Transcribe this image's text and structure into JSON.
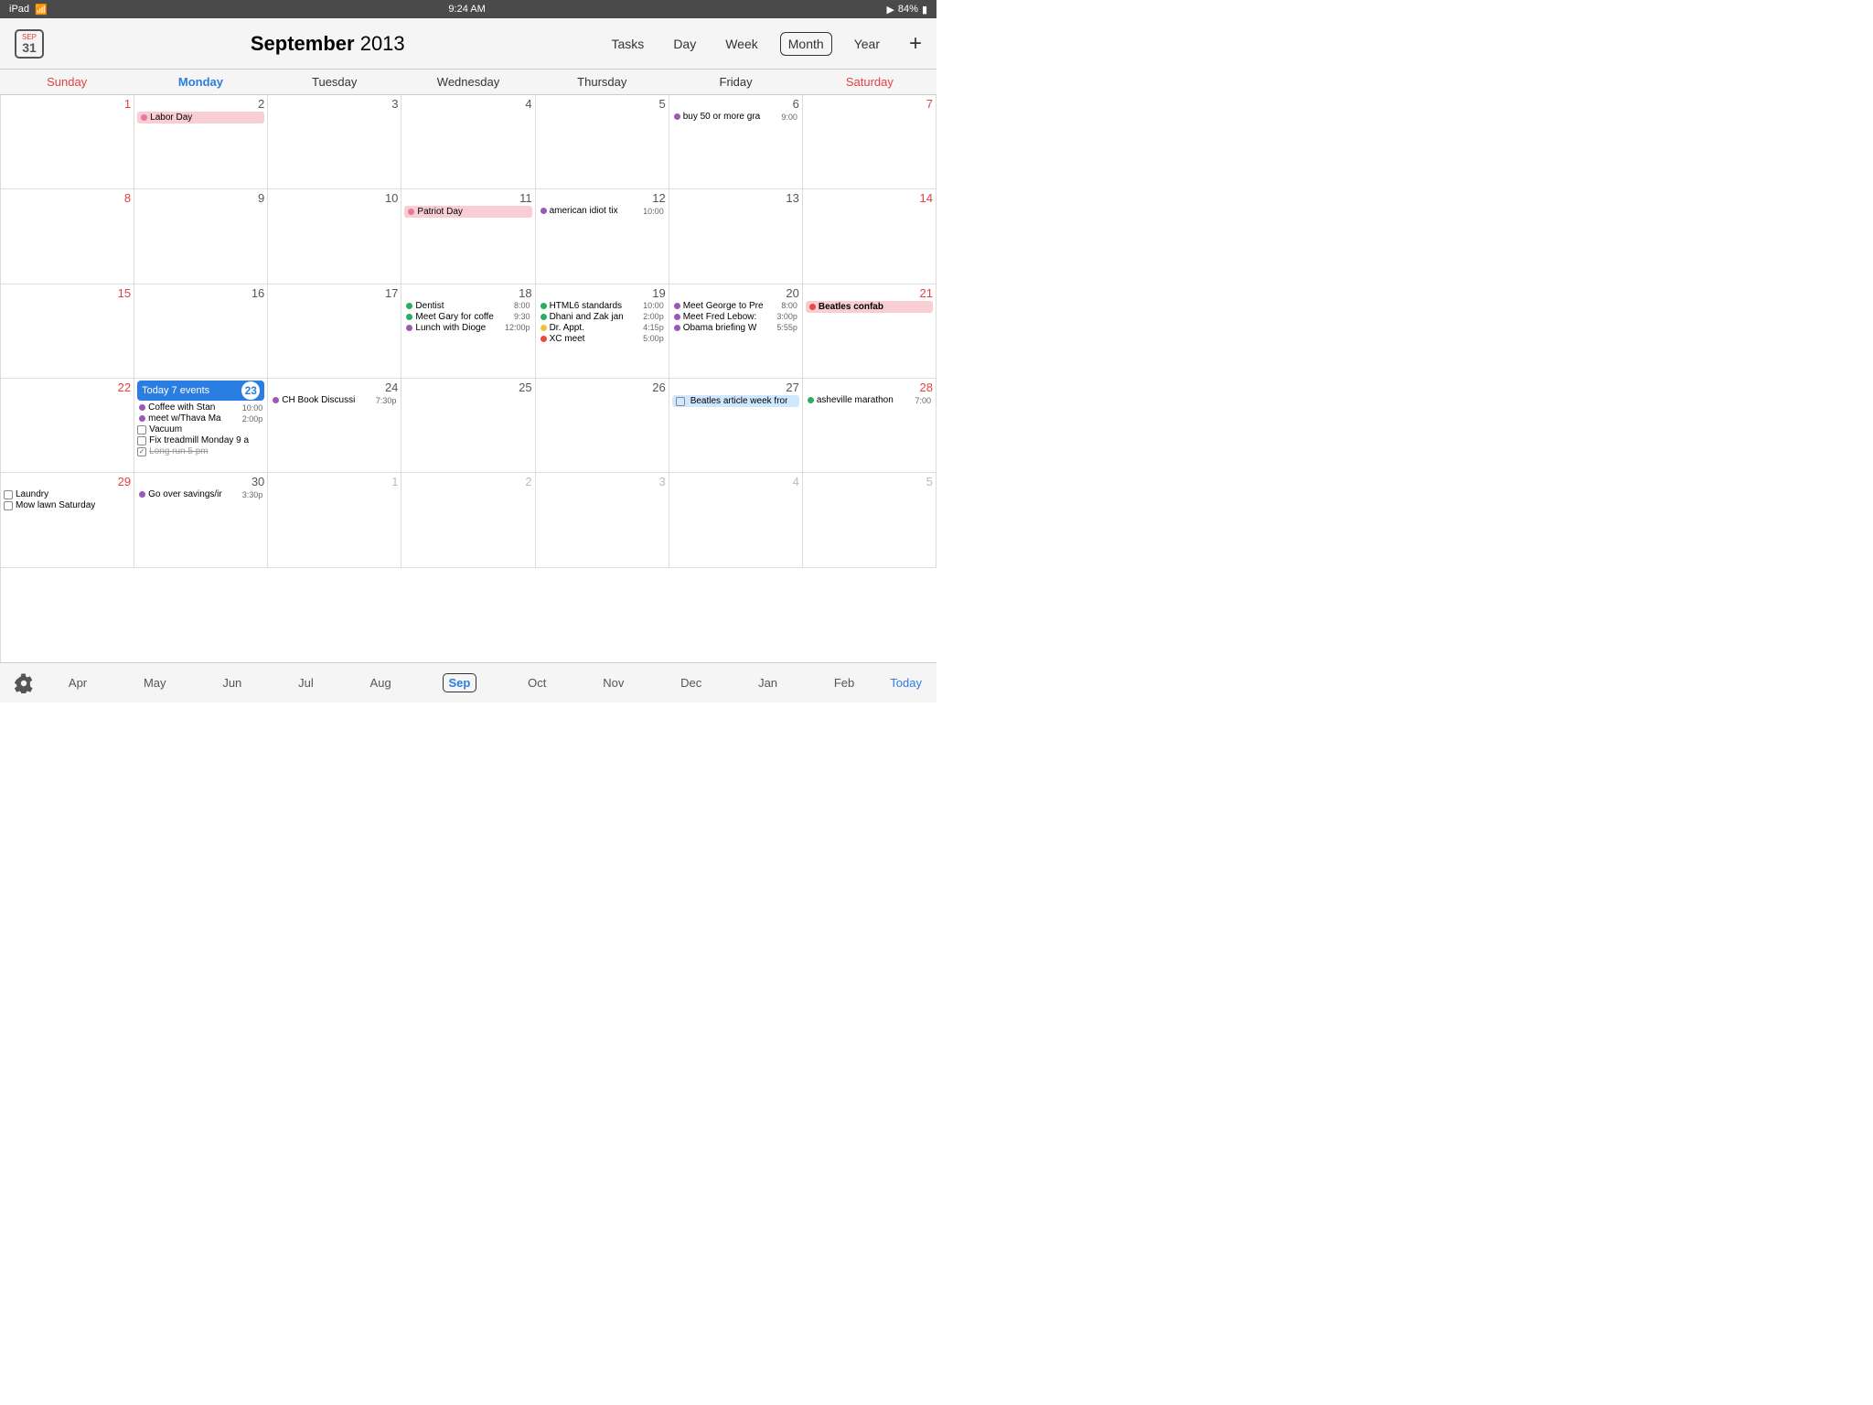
{
  "statusBar": {
    "left": "iPad",
    "wifi": "wifi",
    "time": "9:24 AM",
    "location": "▶",
    "battery": "84%"
  },
  "header": {
    "calIcon": "31",
    "title": "September",
    "year": "2013",
    "nav": {
      "tasks": "Tasks",
      "day": "Day",
      "week": "Week",
      "month": "Month",
      "year": "Year"
    },
    "addBtn": "+"
  },
  "dayHeaders": [
    "Sunday",
    "Monday",
    "Tuesday",
    "Wednesday",
    "Thursday",
    "Friday",
    "Saturday"
  ],
  "weeks": [
    {
      "days": [
        {
          "num": "1",
          "otherMonth": false,
          "events": []
        },
        {
          "num": "2",
          "otherMonth": false,
          "events": [
            {
              "type": "allday",
              "color": "#e8789a",
              "name": "Labor Day"
            }
          ]
        },
        {
          "num": "3",
          "otherMonth": false,
          "events": []
        },
        {
          "num": "4",
          "otherMonth": false,
          "events": []
        },
        {
          "num": "5",
          "otherMonth": false,
          "events": []
        },
        {
          "num": "6",
          "otherMonth": false,
          "events": [
            {
              "type": "timed",
              "color": "#9b59b6",
              "name": "buy 50 or more gra",
              "time": "9:00"
            }
          ]
        },
        {
          "num": "7",
          "otherMonth": false,
          "events": []
        }
      ]
    },
    {
      "days": [
        {
          "num": "8",
          "otherMonth": false,
          "events": []
        },
        {
          "num": "9",
          "otherMonth": false,
          "events": []
        },
        {
          "num": "10",
          "otherMonth": false,
          "events": []
        },
        {
          "num": "11",
          "otherMonth": false,
          "events": [
            {
              "type": "allday",
              "color": "#e8789a",
              "name": "Patriot Day"
            }
          ]
        },
        {
          "num": "12",
          "otherMonth": false,
          "events": [
            {
              "type": "timed",
              "color": "#9b59b6",
              "name": "american idiot tix",
              "time": "10:00"
            }
          ]
        },
        {
          "num": "13",
          "otherMonth": false,
          "events": []
        },
        {
          "num": "14",
          "otherMonth": false,
          "events": []
        }
      ]
    },
    {
      "days": [
        {
          "num": "15",
          "otherMonth": false,
          "events": []
        },
        {
          "num": "16",
          "otherMonth": false,
          "events": []
        },
        {
          "num": "17",
          "otherMonth": false,
          "events": []
        },
        {
          "num": "18",
          "otherMonth": false,
          "events": [
            {
              "type": "timed",
              "color": "#27ae60",
              "name": "Dentist",
              "time": "8:00"
            },
            {
              "type": "timed",
              "color": "#27ae60",
              "name": "Meet Gary for coffe",
              "time": "9:30"
            },
            {
              "type": "timed",
              "color": "#9b59b6",
              "name": "Lunch with Dioge",
              "time": "12:00p"
            }
          ]
        },
        {
          "num": "19",
          "otherMonth": false,
          "events": [
            {
              "type": "timed",
              "color": "#27ae60",
              "name": "HTML6 standards",
              "time": "10:00"
            },
            {
              "type": "timed",
              "color": "#27ae60",
              "name": "Dhani and Zak jan",
              "time": "2:00p"
            },
            {
              "type": "timed",
              "color": "#f0c040",
              "name": "Dr. Appt.",
              "time": "4:15p"
            },
            {
              "type": "timed",
              "color": "#e74c3c",
              "name": "XC meet",
              "time": "5:00p"
            }
          ]
        },
        {
          "num": "20",
          "otherMonth": false,
          "events": [
            {
              "type": "timed",
              "color": "#9b59b6",
              "name": "Meet George to Pre",
              "time": "8:00"
            },
            {
              "type": "timed",
              "color": "#9b59b6",
              "name": "Meet Fred Lebow:",
              "time": "3:00p"
            },
            {
              "type": "timed",
              "color": "#9b59b6",
              "name": "Obama briefing W",
              "time": "5:55p"
            }
          ]
        },
        {
          "num": "21",
          "otherMonth": false,
          "events": [
            {
              "type": "allday-red",
              "color": "#e74c3c",
              "name": "Beatles confab"
            }
          ]
        }
      ]
    },
    {
      "days": [
        {
          "num": "22",
          "otherMonth": false,
          "events": []
        },
        {
          "num": "23",
          "otherMonth": false,
          "isToday": true,
          "todayLabel": "Today 7 events",
          "events": [
            {
              "type": "timed",
              "color": "#9b59b6",
              "name": "Coffee with Stan",
              "time": "10:00"
            },
            {
              "type": "timed",
              "color": "#9b59b6",
              "name": "meet w/Thava Ma",
              "time": "2:00p"
            },
            {
              "type": "task",
              "checked": false,
              "name": "Vacuum"
            },
            {
              "type": "task",
              "checked": false,
              "name": "Fix treadmill Monday 9 a"
            },
            {
              "type": "task",
              "checked": true,
              "name": "Long run 5 pm"
            }
          ]
        },
        {
          "num": "24",
          "otherMonth": false,
          "events": [
            {
              "type": "timed",
              "color": "#9b59b6",
              "name": "CH Book Discussi",
              "time": "7:30p"
            }
          ]
        },
        {
          "num": "25",
          "otherMonth": false,
          "events": []
        },
        {
          "num": "26",
          "otherMonth": false,
          "events": []
        },
        {
          "num": "27",
          "otherMonth": false,
          "events": [
            {
              "type": "task-blue",
              "checked": false,
              "name": "Beatles article week fror"
            }
          ]
        },
        {
          "num": "28",
          "otherMonth": false,
          "events": [
            {
              "type": "timed",
              "color": "#27ae60",
              "name": "asheville marathon",
              "time": "7:00"
            }
          ]
        }
      ]
    },
    {
      "days": [
        {
          "num": "29",
          "otherMonth": false,
          "events": [
            {
              "type": "task",
              "checked": false,
              "name": "Laundry"
            },
            {
              "type": "task",
              "checked": false,
              "name": "Mow lawn Saturday"
            }
          ]
        },
        {
          "num": "30",
          "otherMonth": false,
          "events": [
            {
              "type": "timed",
              "color": "#9b59b6",
              "name": "Go over savings/ir",
              "time": "3:30p"
            }
          ]
        },
        {
          "num": "1",
          "otherMonth": true,
          "events": []
        },
        {
          "num": "2",
          "otherMonth": true,
          "events": []
        },
        {
          "num": "3",
          "otherMonth": true,
          "events": []
        },
        {
          "num": "4",
          "otherMonth": true,
          "events": []
        },
        {
          "num": "5",
          "otherMonth": true,
          "events": []
        }
      ]
    }
  ],
  "monthStrip": {
    "months": [
      "Apr",
      "May",
      "Jun",
      "Jul",
      "Aug",
      "Sep",
      "Oct",
      "Nov",
      "Dec",
      "Jan",
      "Feb"
    ],
    "active": "Sep",
    "today": "Today"
  }
}
